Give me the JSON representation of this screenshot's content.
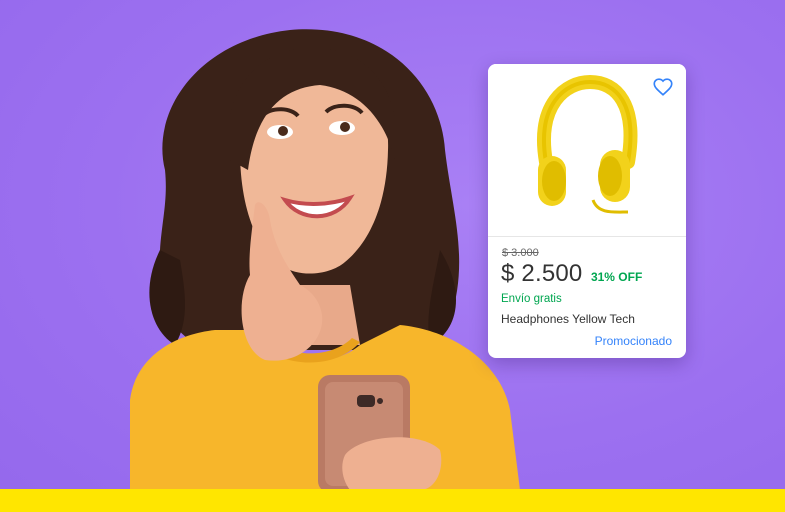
{
  "colors": {
    "background": "#9f73f2",
    "accent_yellow": "#ffe600",
    "discount_green": "#00a650",
    "link_blue": "#3483fa",
    "headphones_yellow": "#f2d21b"
  },
  "product_card": {
    "old_price": "$ 3.000",
    "price": "$ 2.500",
    "discount": "31% OFF",
    "shipping": "Envío gratis",
    "title": "Headphones Yellow Tech",
    "promoted_label": "Promocionado",
    "favorite_icon": "heart-outline-icon",
    "image": "yellow-headphones-image"
  },
  "hero": {
    "image": "smiling-woman-holding-phone-photo"
  }
}
